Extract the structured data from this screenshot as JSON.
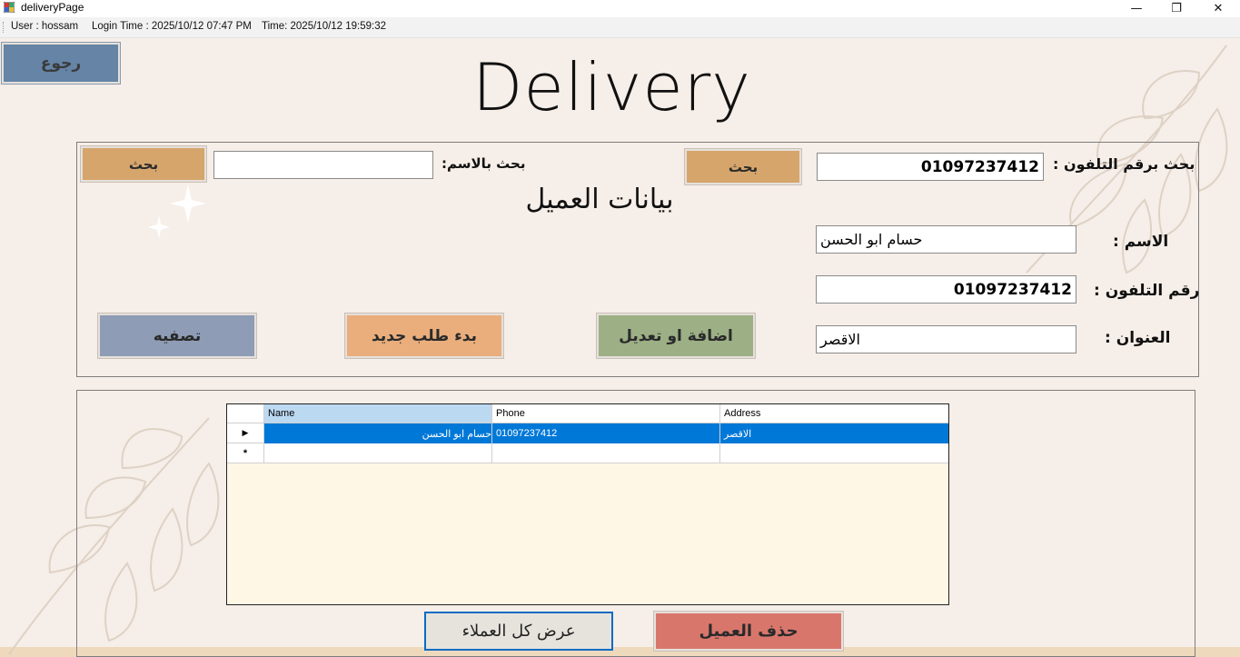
{
  "window": {
    "title": "deliveryPage",
    "minimize": "—",
    "maximize": "❐",
    "close": "✕"
  },
  "status": {
    "user": "User : hossam",
    "login": "Login Time :  2025/10/12 07:47 PM",
    "time": "Time: 2025/10/12 19:59:32"
  },
  "back_button": "رجوع",
  "heading": "Delivery",
  "search": {
    "phone_label": "بحث برقم التلفون :",
    "phone_value": "01097237412",
    "phone_button": "بحث",
    "name_label": "بحث بالاسم:",
    "name_value": "",
    "name_button": "بحث"
  },
  "customer": {
    "section_title": "بيانات العميل",
    "name_label": "الاسم :",
    "name_value": "حسام ابو الحسن",
    "phone_label": "رقم التلفون :",
    "phone_value": "01097237412",
    "address_label": "العنوان :",
    "address_value": "الاقصر"
  },
  "actions": {
    "add_edit": "اضافة او تعديل",
    "new_order": "بدء طلب جديد",
    "clear": "تصفيه"
  },
  "table": {
    "columns": [
      "Name",
      "Phone",
      "Address"
    ],
    "rows": [
      {
        "name": "حسام ابو الحسن",
        "phone": "01097237412",
        "address": "الاقصر"
      }
    ],
    "new_row_marker": "*",
    "current_row_marker": "▶"
  },
  "bottom": {
    "show_all": "عرض كل العملاء",
    "delete": "حذف العميل"
  },
  "colors": {
    "background": "#f6eee8",
    "back_button": "#6584a6",
    "search_button": "#d5a56c",
    "add_edit": "#9caf85",
    "new_order": "#e9ae7c",
    "clear": "#8e9cb5",
    "delete": "#d9766c",
    "show_all": "#e6e3dc",
    "selected_row": "#0078d7",
    "grid_bg": "#fff7e6"
  },
  "icons": [
    "app-icon",
    "sparkle-icon",
    "leaf-decoration"
  ]
}
